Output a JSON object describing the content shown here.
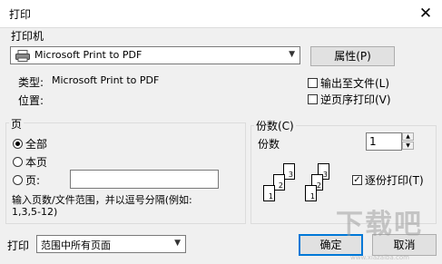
{
  "window": {
    "title": "打印",
    "close_glyph": "✕"
  },
  "printer_group": {
    "label": "打印机",
    "selected_printer": "Microsoft Print to PDF",
    "properties_button": "属性(P)",
    "type_label": "类型:",
    "type_value": "Microsoft Print to PDF",
    "location_label": "位置:",
    "location_value": "",
    "print_to_file": {
      "label": "输出至文件(L)",
      "checked": false
    },
    "reverse_order": {
      "label": "逆页序打印(V)",
      "checked": false
    }
  },
  "page_group": {
    "label": "页",
    "options": [
      {
        "label": "全部",
        "checked": true
      },
      {
        "label": "本页",
        "checked": false
      },
      {
        "label": "页:",
        "checked": false
      }
    ],
    "pages_value": "",
    "hint": "输入页数/文件范围，并以逗号分隔(例如:",
    "hint_example": "1,3,5-12)"
  },
  "copies_group": {
    "label": "份数(C)",
    "copies_label": "份数",
    "copies_value": "1",
    "collate": {
      "label": "逐份打印(T)",
      "checked": true
    },
    "collate_pages": [
      "1",
      "2",
      "3",
      "1",
      "2",
      "3"
    ]
  },
  "footer": {
    "print_label": "打印",
    "range_value": "范围中所有页面",
    "ok_button": "确定",
    "cancel_button": "取消"
  },
  "watermark": {
    "text": "下载吧",
    "sub": "www.xiazaiba.com"
  },
  "colors": {
    "accent": "#0078d7",
    "dialog_bg": "#f0f0f0",
    "button_bg": "#e1e1e1"
  },
  "icons": [
    "close-icon",
    "printer-icon",
    "chevron-down-icon",
    "spin-up-icon",
    "spin-down-icon",
    "checkmark-icon"
  ]
}
